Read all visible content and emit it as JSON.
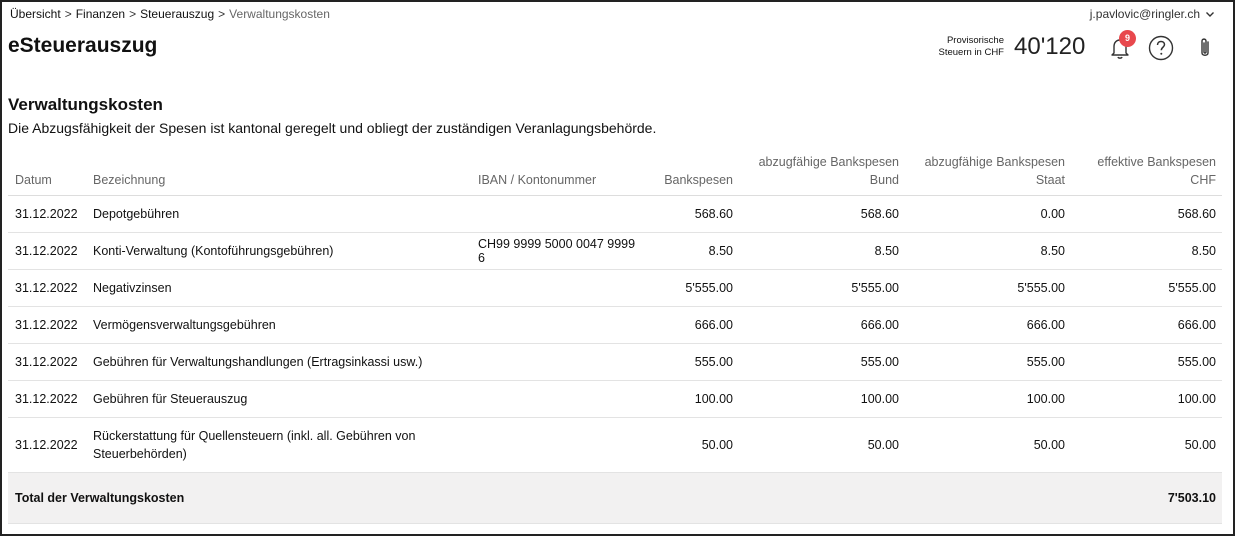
{
  "breadcrumb": {
    "items": [
      "Übersicht",
      "Finanzen",
      "Steuerauszug"
    ],
    "current": "Verwaltungskosten",
    "separator": ">"
  },
  "user": {
    "email": "j.pavlovic@ringler.ch",
    "icon": "chevron-down-icon"
  },
  "app": {
    "title": "eSteuerauszug"
  },
  "header": {
    "tax_label_line1": "Provisorische",
    "tax_label_line2": "Steuern in CHF",
    "tax_value": "40'120",
    "notification_count": "9",
    "icons": [
      "bell-icon",
      "help-icon",
      "paperclip-icon"
    ],
    "badge_color": "#e8484d"
  },
  "section": {
    "title": "Verwaltungskosten",
    "description": "Die Abzugsfähigkeit der Spesen ist kantonal geregelt und obliegt der zuständigen Veranlagungsbehörde."
  },
  "table": {
    "columns": {
      "datum": "Datum",
      "bezeichnung": "Bezeichnung",
      "iban": "IBAN / Kontonummer",
      "bankspesen": "Bankspesen",
      "bund_line1": "abzugfähige Bankspesen",
      "bund_line2": "Bund",
      "staat_line1": "abzugfähige Bankspesen",
      "staat_line2": "Staat",
      "eff_line1": "effektive Bankspesen",
      "eff_line2": "CHF"
    },
    "rows": [
      {
        "datum": "31.12.2022",
        "bezeichnung": "Depotgebühren",
        "iban": "",
        "bankspesen": "568.60",
        "bund": "568.60",
        "staat": "0.00",
        "effektiv": "568.60"
      },
      {
        "datum": "31.12.2022",
        "bezeichnung": "Konti-Verwaltung (Kontoführungsgebühren)",
        "iban": "CH99 9999 5000 0047 9999 6",
        "bankspesen": "8.50",
        "bund": "8.50",
        "staat": "8.50",
        "effektiv": "8.50"
      },
      {
        "datum": "31.12.2022",
        "bezeichnung": "Negativzinsen",
        "iban": "",
        "bankspesen": "5'555.00",
        "bund": "5'555.00",
        "staat": "5'555.00",
        "effektiv": "5'555.00"
      },
      {
        "datum": "31.12.2022",
        "bezeichnung": "Vermögensverwaltungsgebühren",
        "iban": "",
        "bankspesen": "666.00",
        "bund": "666.00",
        "staat": "666.00",
        "effektiv": "666.00"
      },
      {
        "datum": "31.12.2022",
        "bezeichnung": "Gebühren für Verwaltungshandlungen (Ertragsinkassi usw.)",
        "iban": "",
        "bankspesen": "555.00",
        "bund": "555.00",
        "staat": "555.00",
        "effektiv": "555.00"
      },
      {
        "datum": "31.12.2022",
        "bezeichnung": "Gebühren für Steuerauszug",
        "iban": "",
        "bankspesen": "100.00",
        "bund": "100.00",
        "staat": "100.00",
        "effektiv": "100.00"
      },
      {
        "datum": "31.12.2022",
        "bezeichnung_line1": "Rückerstattung für Quellensteuern (inkl. all. Gebühren von",
        "bezeichnung_line2": "Steuerbehörden)",
        "iban": "",
        "bankspesen": "50.00",
        "bund": "50.00",
        "staat": "50.00",
        "effektiv": "50.00"
      }
    ],
    "total": {
      "label": "Total der Verwaltungskosten",
      "value": "7'503.10"
    }
  }
}
